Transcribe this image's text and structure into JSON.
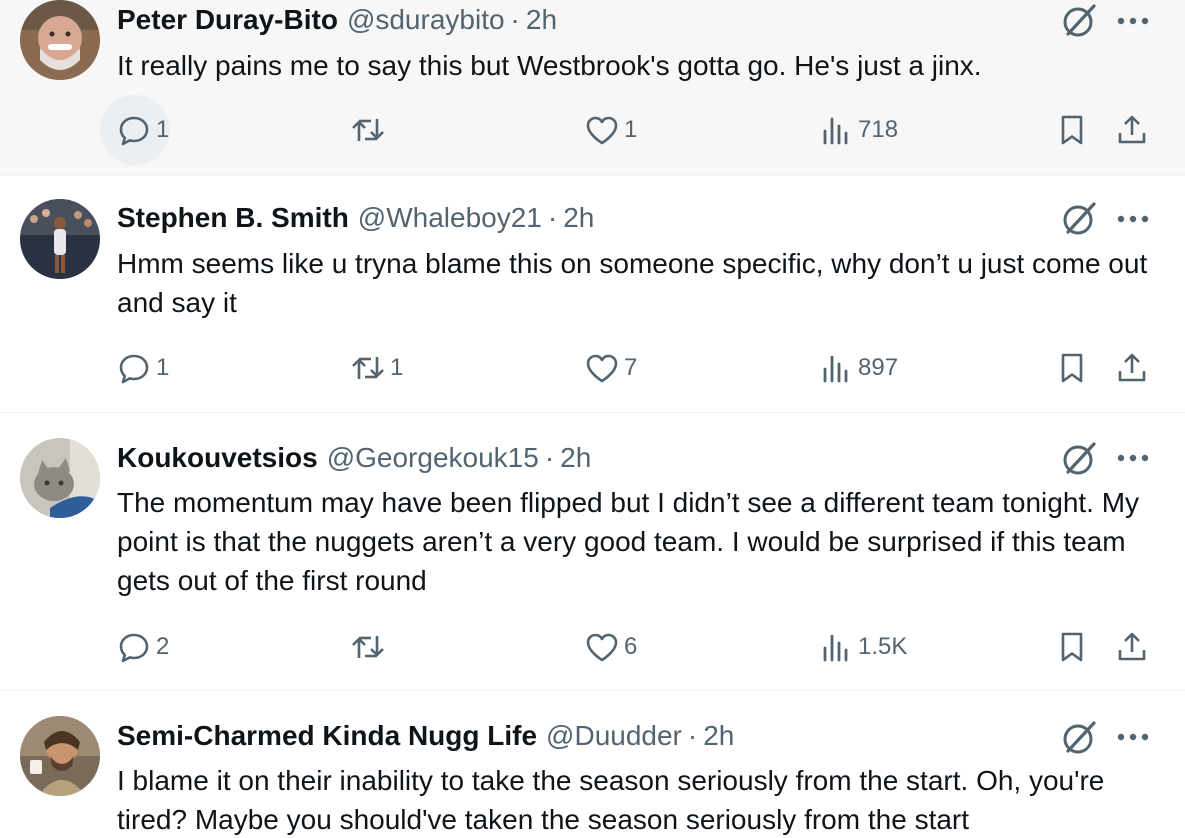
{
  "colors": {
    "text_primary": "#0f1419",
    "text_secondary": "#536471",
    "divider": "#eff3f4",
    "hover_bg": "#f7f7f7"
  },
  "tweets": [
    {
      "name": "Peter Duray-Bito",
      "handle": "@sduraybito",
      "separator": "·",
      "time": "2h",
      "text": "It really pains me to say this but Westbrook's gotta go. He's just a jinx.",
      "replies": "1",
      "reposts": "",
      "likes": "1",
      "views": "718"
    },
    {
      "name": "Stephen B. Smith",
      "handle": "@Whaleboy21",
      "separator": "·",
      "time": "2h",
      "text": "Hmm seems like u tryna blame this on someone specific, why don’t u just come out and say it",
      "replies": "1",
      "reposts": "1",
      "likes": "7",
      "views": "897"
    },
    {
      "name": "Koukouvetsios",
      "handle": "@Georgekouk15",
      "separator": "·",
      "time": "2h",
      "text": "The momentum may have been flipped but I didn’t see a different team tonight. My point is that the nuggets aren’t a very good team. I would be surprised if this team gets out of the first round",
      "replies": "2",
      "reposts": "",
      "likes": "6",
      "views": "1.5K"
    },
    {
      "name": "Semi-Charmed Kinda Nugg Life",
      "handle": "@Duudder",
      "separator": "·",
      "time": "2h",
      "text": "I blame it on their inability to take the season seriously from the start. Oh, you're tired? Maybe you should've taken the season seriously from the start",
      "replies": "",
      "reposts": "",
      "likes": "",
      "views": ""
    }
  ],
  "icons": {
    "reply": "speech-bubble-icon",
    "repost": "repost-arrows-icon",
    "like": "heart-icon",
    "views": "bar-chart-icon",
    "bookmark": "bookmark-icon",
    "share": "share-upload-icon",
    "grok": "grok-slash-circle-icon",
    "more": "ellipsis-icon"
  }
}
